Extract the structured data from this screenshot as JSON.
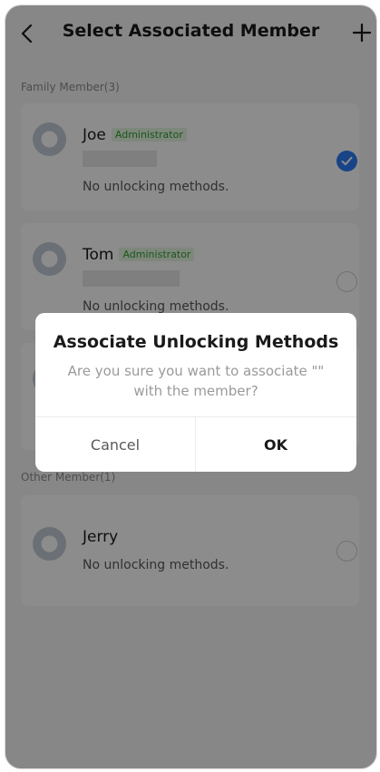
{
  "header": {
    "title": "Select Associated Member"
  },
  "family_section": {
    "label": "Family Member(3)",
    "members": [
      {
        "name": "Joe",
        "role": "Administrator",
        "status": "No unlocking methods.",
        "selected": true
      },
      {
        "name": "Tom",
        "role": "Administrator",
        "status": "No unlocking methods.",
        "selected": false
      }
    ]
  },
  "other_section": {
    "label": "Other Member(1)",
    "members": [
      {
        "name": "Jerry",
        "status": "No unlocking methods.",
        "selected": false
      }
    ]
  },
  "dialog": {
    "title": "Associate Unlocking Methods",
    "message": "Are you sure you want to associate \"\" with the member?",
    "cancel_label": "Cancel",
    "ok_label": "OK"
  },
  "colors": {
    "accent": "#2d7cf6",
    "badge_text": "#2f9e2f",
    "badge_bg": "#e5f6e2",
    "overlay": "rgba(0,0,0,0.45)"
  },
  "icons": {
    "back": "chevron-left-icon",
    "add": "plus-icon",
    "avatar": "user-avatar-icon",
    "check": "check-icon"
  }
}
